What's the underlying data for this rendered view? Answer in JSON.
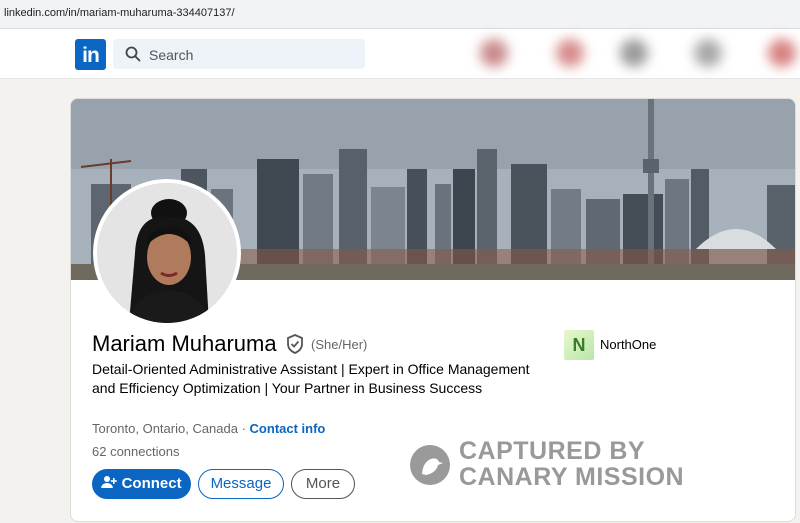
{
  "browser": {
    "url": "linkedin.com/in/mariam-muharuma-334407137/"
  },
  "nav": {
    "logo_text": "in",
    "search_placeholder": "Search"
  },
  "profile": {
    "name": "Mariam Muharuma",
    "pronouns": "(She/Her)",
    "headline": "Detail-Oriented Administrative Assistant | Expert in Office Management and Efficiency Optimization | Your Partner in Business Success",
    "location": "Toronto, Ontario, Canada",
    "location_separator": " · ",
    "contact_info_label": "Contact info",
    "connections": "62 connections",
    "company": {
      "name": "NorthOne",
      "logo_letter": "N"
    }
  },
  "actions": {
    "connect_label": "Connect",
    "message_label": "Message",
    "more_label": "More"
  },
  "watermark": {
    "line1": "CAPTURED BY",
    "line2": "CANARY MISSION"
  },
  "colors": {
    "brand": "#0a66c2",
    "page_bg": "#f4f2ee",
    "search_bg": "#edf3f8"
  }
}
